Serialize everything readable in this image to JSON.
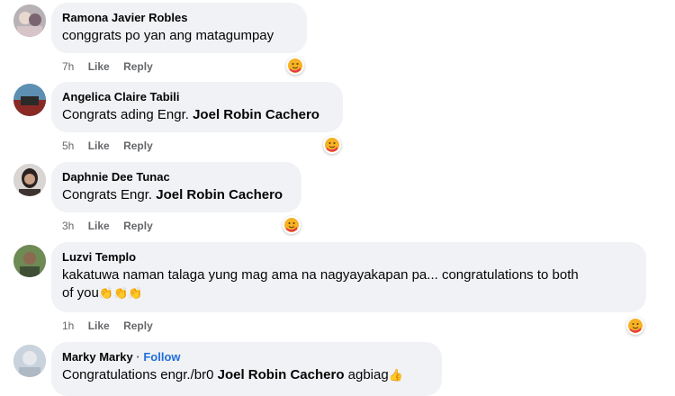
{
  "comments": [
    {
      "author": "Ramona Javier Robles",
      "text": "conggrats po yan ang matagumpay",
      "time": "7h",
      "like": "Like",
      "reply": "Reply",
      "reaction": "care-emoji"
    },
    {
      "author": "Angelica Claire Tabili",
      "text_prefix": "Congrats ading Engr. ",
      "mention": "Joel Robin Cachero",
      "time": "5h",
      "like": "Like",
      "reply": "Reply",
      "reaction": "care-emoji"
    },
    {
      "author": "Daphnie Dee Tunac",
      "text_prefix": "Congrats Engr. ",
      "mention": "Joel Robin Cachero",
      "time": "3h",
      "like": "Like",
      "reply": "Reply",
      "reaction": "care-emoji"
    },
    {
      "author": "Luzvi Templo",
      "text_line1": "kakatuwa naman talaga yung mag ama na nagyayakapan pa... congratulations to both",
      "text_line2": "of you",
      "time": "1h",
      "like": "Like",
      "reply": "Reply",
      "reaction": "care-emoji",
      "emoji": "clapping-hands x3"
    },
    {
      "author": "Marky Marky",
      "separator": " · ",
      "follow": "Follow",
      "text_prefix": "Congratulations engr./br0 ",
      "mention": "Joel Robin Cachero",
      "text_suffix": " agbiag",
      "emoji": "thumbs-up"
    }
  ],
  "colors": {
    "bubble": "#f0f2f5",
    "meta": "#65676b",
    "follow": "#216fdb"
  }
}
